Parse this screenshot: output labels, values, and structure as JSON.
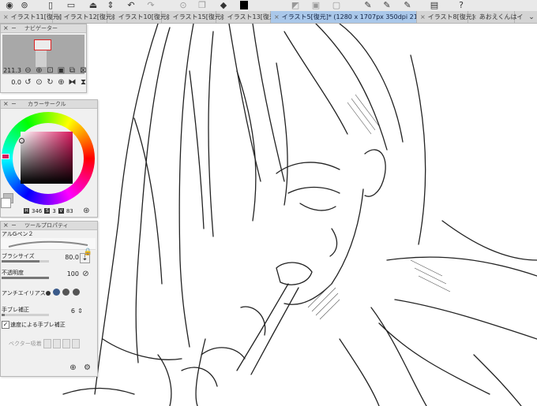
{
  "toolbar": {
    "icons": [
      "eye-icon",
      "file-icon",
      "upload-icon",
      "chevron-updown-icon",
      "undo-icon",
      "redo-icon",
      "lasso-icon",
      "copy-icon",
      "fill-icon",
      "color-swatch-icon",
      "blend-icon",
      "layer-icon",
      "pen-icon",
      "pen-icon",
      "pen-icon",
      "layers-icon",
      "help-icon"
    ],
    "main_color": "#000000"
  },
  "tabs": [
    {
      "label": "イラスト11[復元]",
      "active": false
    },
    {
      "label": "イラスト12[復元]",
      "active": false
    },
    {
      "label": "イラスト10[復元]",
      "active": false
    },
    {
      "label": "イラスト15[復元]",
      "active": false
    },
    {
      "label": "イラスト13[復元]",
      "active": false
    },
    {
      "label": "イラスト5[復元]* (1280 x 1707px 350dpi 211.3%)",
      "active": true
    },
    {
      "label": "イラスト8[復元]",
      "active": false
    },
    {
      "label": "あおえくんはイ",
      "active": false
    }
  ],
  "navigator": {
    "title": "ナビゲーター",
    "zoom": "211.3",
    "rotation": "0.0"
  },
  "color_circle": {
    "title": "カラーサークル",
    "mode": "HSV",
    "h": "346",
    "s": "3",
    "v": "83",
    "current_color": "#d9185e"
  },
  "tool_property": {
    "title": "ツールプロパティ",
    "brush_name": "アルGペン２",
    "brush_size_label": "ブラシサイズ",
    "brush_size": "80.0",
    "opacity_label": "不透明度",
    "opacity": "100",
    "antialias_label": "アンチエイリアス",
    "stabilization_label": "手ブレ補正",
    "stabilization": "6",
    "speed_stabilization_label": "速度による手ブレ補正",
    "speed_stabilization_checked": true,
    "vector_snap_label": "ベクター吸着"
  }
}
